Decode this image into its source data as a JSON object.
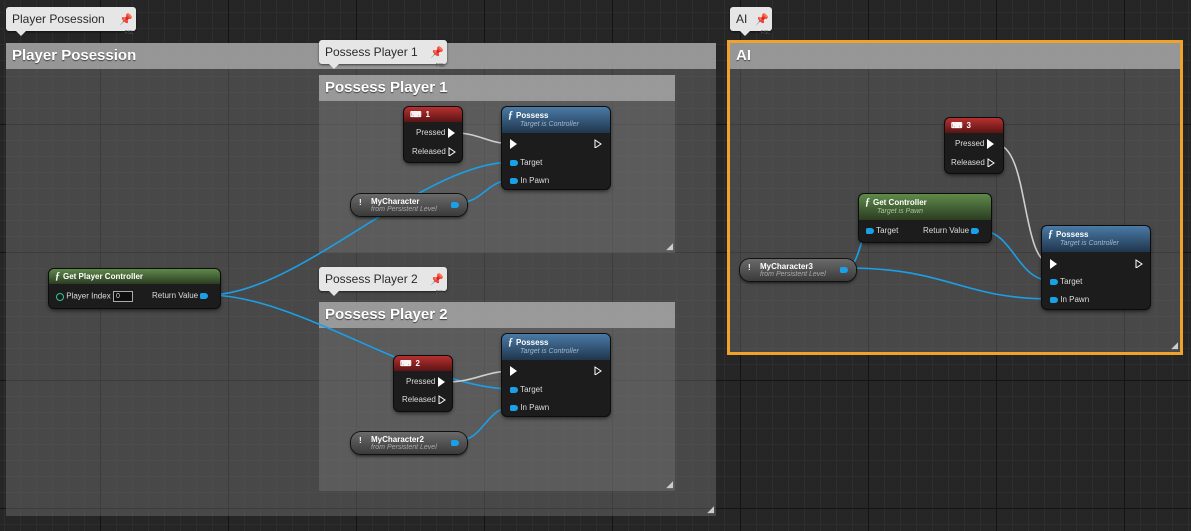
{
  "bubbles": {
    "player": "Player Posession",
    "ai": "AI",
    "p1": "Possess Player 1",
    "p2": "Possess Player 2"
  },
  "comments": {
    "player": "Player Posession",
    "ai": "AI",
    "p1": "Possess Player 1",
    "p2": "Possess Player 2"
  },
  "pin_glyph": "📌",
  "pin_small": "FSL",
  "nodes": {
    "get_pc": {
      "title": "Get Player Controller",
      "player_index_label": "Player Index",
      "player_index_value": "0",
      "return_label": "Return Value"
    },
    "key1": {
      "title": "1",
      "pressed": "Pressed",
      "released": "Released"
    },
    "key2": {
      "title": "2",
      "pressed": "Pressed",
      "released": "Released"
    },
    "key3": {
      "title": "3",
      "pressed": "Pressed",
      "released": "Released"
    },
    "possess1": {
      "title": "Possess",
      "sub": "Target is Controller",
      "target": "Target",
      "in_pawn": "In Pawn"
    },
    "possess2": {
      "title": "Possess",
      "sub": "Target is Controller",
      "target": "Target",
      "in_pawn": "In Pawn"
    },
    "possess3": {
      "title": "Possess",
      "sub": "Target is Controller",
      "target": "Target",
      "in_pawn": "In Pawn"
    },
    "get_controller": {
      "title": "Get Controller",
      "sub": "Target is Pawn",
      "target": "Target",
      "return_label": "Return Value"
    },
    "char1": {
      "title": "MyCharacter",
      "sub": "from Persistent Level"
    },
    "char2": {
      "title": "MyCharacter2",
      "sub": "from Persistent Level"
    },
    "char3": {
      "title": "MyCharacter3",
      "sub": "from Persistent Level"
    }
  },
  "icons": {
    "function": "ƒ",
    "key": "⌨",
    "bang": "!"
  },
  "colors": {
    "selection": "#f0a22a",
    "object_wire": "#1aa0e8",
    "exec_wire": "#e8e8e8",
    "key_header": "#b83030",
    "function_header": "#4a7aa6",
    "pure_header": "#5f8a4a"
  }
}
